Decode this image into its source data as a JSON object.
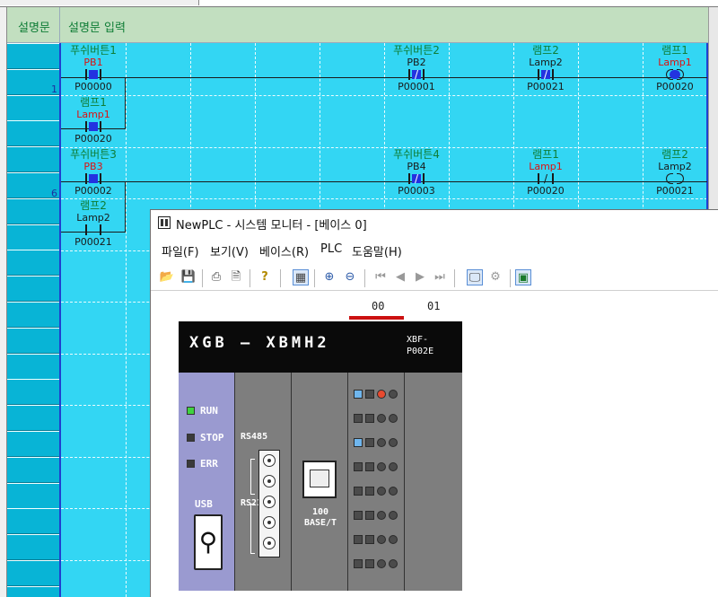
{
  "comment_row": {
    "label": "설명문",
    "text": "설명문 입력"
  },
  "rows": [
    {
      "num": "1"
    },
    {
      "num": "6"
    }
  ],
  "rung1": {
    "pb1": {
      "comment": "푸쉬버튼1",
      "symbol": "PB1",
      "address": "P00000"
    },
    "pb2": {
      "comment": "푸쉬버튼2",
      "symbol": "PB2",
      "address": "P00001"
    },
    "lamp2_nc": {
      "comment": "램프2",
      "symbol": "Lamp2",
      "address": "P00021"
    },
    "lamp1_coil": {
      "comment": "램프1",
      "symbol": "Lamp1",
      "address": "P00020"
    },
    "lamp1_seal": {
      "comment": "램프1",
      "symbol": "Lamp1",
      "address": "P00020"
    }
  },
  "rung2": {
    "pb3": {
      "comment": "푸쉬버튼3",
      "symbol": "PB3",
      "address": "P00002"
    },
    "pb4": {
      "comment": "푸쉬버튼4",
      "symbol": "PB4",
      "address": "P00003"
    },
    "lamp1_nc": {
      "comment": "램프1",
      "symbol": "Lamp1",
      "address": "P00020"
    },
    "lamp2_coil": {
      "comment": "램프2",
      "symbol": "Lamp2",
      "address": "P00021"
    },
    "lamp2_seal": {
      "comment": "램프2",
      "symbol": "Lamp2",
      "address": "P00021"
    }
  },
  "window": {
    "title": "NewPLC - 시스템 모니터 - [베이스 0]",
    "menu": [
      "파일(F)",
      "보기(V)",
      "베이스(R)",
      "PLC",
      "도움말(H)"
    ],
    "toolbar_icons": [
      "open-icon",
      "save-icon",
      "print-icon",
      "print-preview-icon",
      "help-icon",
      "base-view-icon",
      "zoom-in-icon",
      "zoom-out-icon",
      "first-icon",
      "prev-icon",
      "next-icon",
      "last-icon",
      "monitor-icon",
      "module-info-icon",
      "system-icon"
    ]
  },
  "plc": {
    "slots": [
      "00",
      "01"
    ],
    "brand_top": "XGB —",
    "brand_model": "XBMH2",
    "exp_model": "XBF-\nP002E",
    "leds": [
      {
        "label": "RUN",
        "color": "#3fd33f"
      },
      {
        "label": "STOP",
        "color": "#3a3a3a"
      },
      {
        "label": "ERR",
        "color": "#3a3a3a"
      }
    ],
    "usb_label": "USB",
    "rs485_label": "RS485",
    "rs232_label": "RS232C",
    "eth_label": "100\nBASE/T",
    "io_colors": {
      "active_blue": "#6fb6ee",
      "active_red": "#e84a2f",
      "off": "#4b4b4b"
    }
  }
}
